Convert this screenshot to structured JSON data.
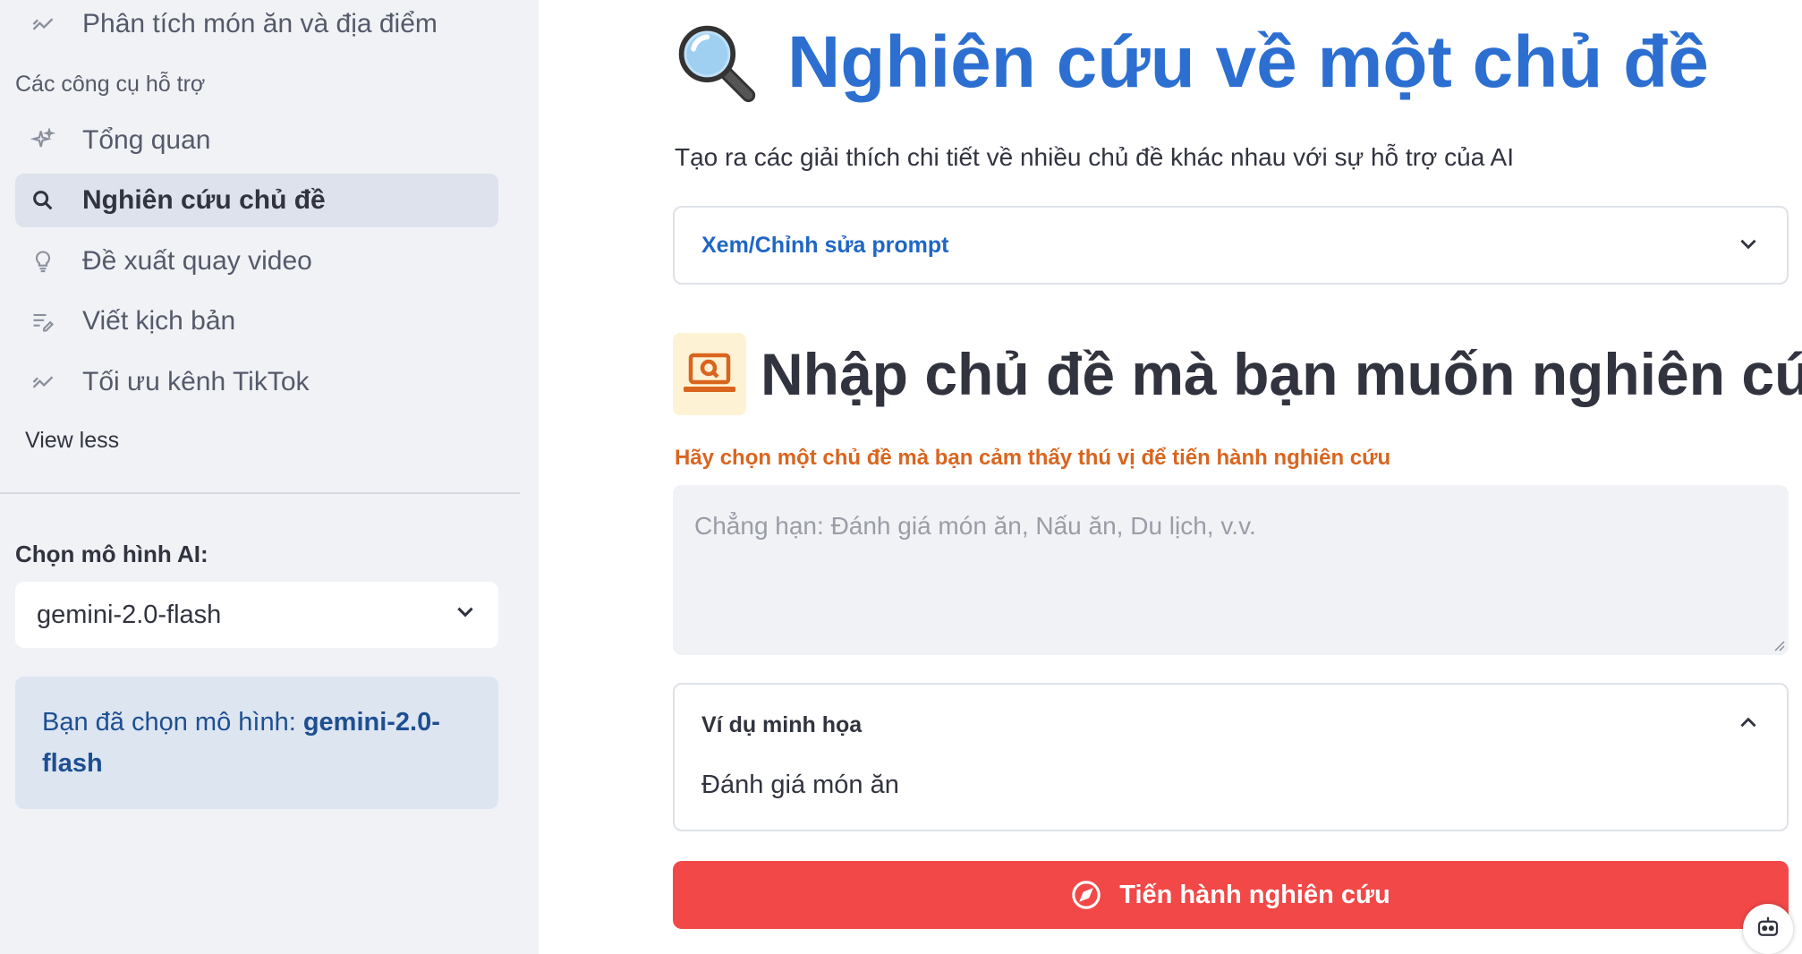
{
  "sidebar": {
    "items": [
      {
        "label": "Phân tích món ăn và địa điểm",
        "icon": "trend-icon"
      },
      {
        "label": "Tổng quan",
        "icon": "sparkle-icon"
      },
      {
        "label": "Nghiên cứu chủ đề",
        "icon": "search-icon",
        "active": true
      },
      {
        "label": "Đề xuất quay video",
        "icon": "lightbulb-icon"
      },
      {
        "label": "Viết kịch bản",
        "icon": "edit-note-icon"
      },
      {
        "label": "Tối ưu kênh TikTok",
        "icon": "trend-icon"
      }
    ],
    "section_label": "Các công cụ hỗ trợ",
    "view_less": "View less",
    "model_label": "Chọn mô hình AI:",
    "model_value": "gemini-2.0-flash",
    "model_info_prefix": "Bạn đã chọn mô hình: ",
    "model_info_value": "gemini-2.0-flash"
  },
  "main": {
    "title": "Nghiên cứu về một chủ đề",
    "subtitle": "Tạo ra các giải thích chi tiết về nhiều chủ đề khác nhau với sự hỗ trợ của AI",
    "prompt_expander": "Xem/Chỉnh sửa prompt",
    "section_title": "Nhập chủ đề mà bạn muốn nghiên cứu",
    "hint": "Hãy chọn một chủ đề mà bạn cảm thấy thú vị để tiến hành nghiên cứu",
    "input_placeholder": "Chẳng hạn: Đánh giá món ăn, Nấu ăn, Du lịch, v.v.",
    "example_expander": "Ví dụ minh họa",
    "example_text": "Đánh giá món ăn",
    "submit_label": "Tiến hành nghiên cứu"
  },
  "colors": {
    "accent_blue": "#2c6fd1",
    "hint_orange": "#d9651f",
    "submit_red": "#f24848",
    "sidebar_bg": "#f0f2f6"
  }
}
